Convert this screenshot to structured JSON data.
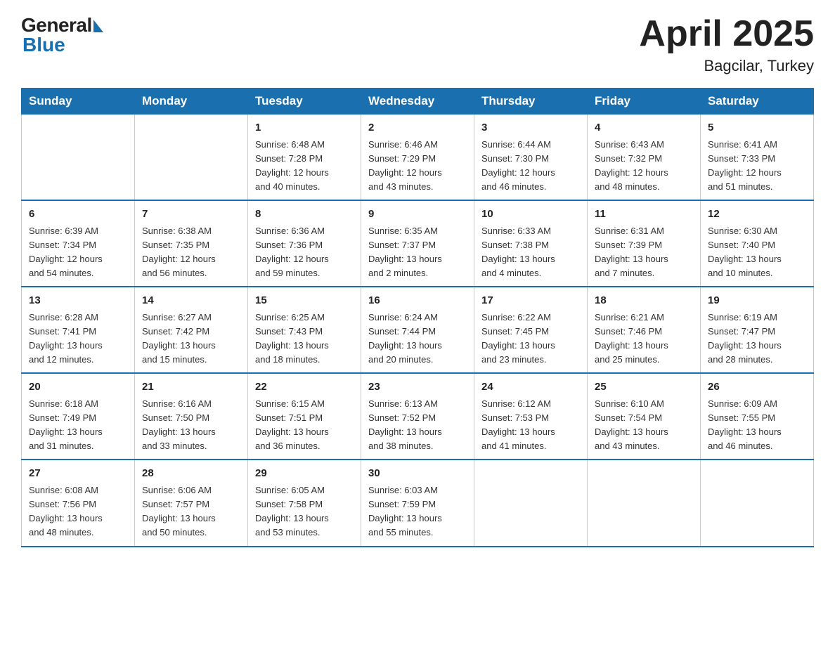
{
  "header": {
    "logo_general": "General",
    "logo_blue": "Blue",
    "month_year": "April 2025",
    "location": "Bagcilar, Turkey"
  },
  "days_of_week": [
    "Sunday",
    "Monday",
    "Tuesday",
    "Wednesday",
    "Thursday",
    "Friday",
    "Saturday"
  ],
  "weeks": [
    [
      {
        "day": "",
        "info": ""
      },
      {
        "day": "",
        "info": ""
      },
      {
        "day": "1",
        "info": "Sunrise: 6:48 AM\nSunset: 7:28 PM\nDaylight: 12 hours\nand 40 minutes."
      },
      {
        "day": "2",
        "info": "Sunrise: 6:46 AM\nSunset: 7:29 PM\nDaylight: 12 hours\nand 43 minutes."
      },
      {
        "day": "3",
        "info": "Sunrise: 6:44 AM\nSunset: 7:30 PM\nDaylight: 12 hours\nand 46 minutes."
      },
      {
        "day": "4",
        "info": "Sunrise: 6:43 AM\nSunset: 7:32 PM\nDaylight: 12 hours\nand 48 minutes."
      },
      {
        "day": "5",
        "info": "Sunrise: 6:41 AM\nSunset: 7:33 PM\nDaylight: 12 hours\nand 51 minutes."
      }
    ],
    [
      {
        "day": "6",
        "info": "Sunrise: 6:39 AM\nSunset: 7:34 PM\nDaylight: 12 hours\nand 54 minutes."
      },
      {
        "day": "7",
        "info": "Sunrise: 6:38 AM\nSunset: 7:35 PM\nDaylight: 12 hours\nand 56 minutes."
      },
      {
        "day": "8",
        "info": "Sunrise: 6:36 AM\nSunset: 7:36 PM\nDaylight: 12 hours\nand 59 minutes."
      },
      {
        "day": "9",
        "info": "Sunrise: 6:35 AM\nSunset: 7:37 PM\nDaylight: 13 hours\nand 2 minutes."
      },
      {
        "day": "10",
        "info": "Sunrise: 6:33 AM\nSunset: 7:38 PM\nDaylight: 13 hours\nand 4 minutes."
      },
      {
        "day": "11",
        "info": "Sunrise: 6:31 AM\nSunset: 7:39 PM\nDaylight: 13 hours\nand 7 minutes."
      },
      {
        "day": "12",
        "info": "Sunrise: 6:30 AM\nSunset: 7:40 PM\nDaylight: 13 hours\nand 10 minutes."
      }
    ],
    [
      {
        "day": "13",
        "info": "Sunrise: 6:28 AM\nSunset: 7:41 PM\nDaylight: 13 hours\nand 12 minutes."
      },
      {
        "day": "14",
        "info": "Sunrise: 6:27 AM\nSunset: 7:42 PM\nDaylight: 13 hours\nand 15 minutes."
      },
      {
        "day": "15",
        "info": "Sunrise: 6:25 AM\nSunset: 7:43 PM\nDaylight: 13 hours\nand 18 minutes."
      },
      {
        "day": "16",
        "info": "Sunrise: 6:24 AM\nSunset: 7:44 PM\nDaylight: 13 hours\nand 20 minutes."
      },
      {
        "day": "17",
        "info": "Sunrise: 6:22 AM\nSunset: 7:45 PM\nDaylight: 13 hours\nand 23 minutes."
      },
      {
        "day": "18",
        "info": "Sunrise: 6:21 AM\nSunset: 7:46 PM\nDaylight: 13 hours\nand 25 minutes."
      },
      {
        "day": "19",
        "info": "Sunrise: 6:19 AM\nSunset: 7:47 PM\nDaylight: 13 hours\nand 28 minutes."
      }
    ],
    [
      {
        "day": "20",
        "info": "Sunrise: 6:18 AM\nSunset: 7:49 PM\nDaylight: 13 hours\nand 31 minutes."
      },
      {
        "day": "21",
        "info": "Sunrise: 6:16 AM\nSunset: 7:50 PM\nDaylight: 13 hours\nand 33 minutes."
      },
      {
        "day": "22",
        "info": "Sunrise: 6:15 AM\nSunset: 7:51 PM\nDaylight: 13 hours\nand 36 minutes."
      },
      {
        "day": "23",
        "info": "Sunrise: 6:13 AM\nSunset: 7:52 PM\nDaylight: 13 hours\nand 38 minutes."
      },
      {
        "day": "24",
        "info": "Sunrise: 6:12 AM\nSunset: 7:53 PM\nDaylight: 13 hours\nand 41 minutes."
      },
      {
        "day": "25",
        "info": "Sunrise: 6:10 AM\nSunset: 7:54 PM\nDaylight: 13 hours\nand 43 minutes."
      },
      {
        "day": "26",
        "info": "Sunrise: 6:09 AM\nSunset: 7:55 PM\nDaylight: 13 hours\nand 46 minutes."
      }
    ],
    [
      {
        "day": "27",
        "info": "Sunrise: 6:08 AM\nSunset: 7:56 PM\nDaylight: 13 hours\nand 48 minutes."
      },
      {
        "day": "28",
        "info": "Sunrise: 6:06 AM\nSunset: 7:57 PM\nDaylight: 13 hours\nand 50 minutes."
      },
      {
        "day": "29",
        "info": "Sunrise: 6:05 AM\nSunset: 7:58 PM\nDaylight: 13 hours\nand 53 minutes."
      },
      {
        "day": "30",
        "info": "Sunrise: 6:03 AM\nSunset: 7:59 PM\nDaylight: 13 hours\nand 55 minutes."
      },
      {
        "day": "",
        "info": ""
      },
      {
        "day": "",
        "info": ""
      },
      {
        "day": "",
        "info": ""
      }
    ]
  ]
}
